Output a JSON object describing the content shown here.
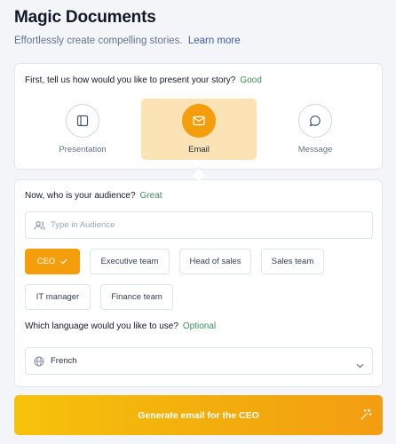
{
  "header": {
    "title": "Magic Documents",
    "subtitle": "Effortlessly create compelling stories.",
    "learn_more": "Learn more"
  },
  "present": {
    "question": "First, tell us how would you like to present your story?",
    "hint": "Good",
    "options": [
      {
        "label": "Presentation",
        "icon": "presentation-icon",
        "selected": false
      },
      {
        "label": "Email",
        "icon": "mail-icon",
        "selected": true
      },
      {
        "label": "Message",
        "icon": "chat-bubble-icon",
        "selected": false
      }
    ]
  },
  "audience": {
    "question": "Now, who is your audience?",
    "hint": "Great",
    "placeholder": "Type in Audience",
    "chips": [
      {
        "label": "CEO",
        "selected": true
      },
      {
        "label": "Executive team",
        "selected": false
      },
      {
        "label": "Head of sales",
        "selected": false
      },
      {
        "label": "Sales team",
        "selected": false
      },
      {
        "label": "IT manager",
        "selected": false
      },
      {
        "label": "Finance team",
        "selected": false
      }
    ]
  },
  "language": {
    "question": "Which language would you like to use?",
    "hint": "Optional",
    "value": "French",
    "icon": "globe-icon"
  },
  "generate": {
    "label": "Generate email for the CEO",
    "icon": "magic-wand-icon"
  },
  "colors": {
    "accent": "#f59e0b",
    "selected_bg": "#fbe3b6",
    "hint_green": "#3f8f5a",
    "link_blue": "#3b5ba8"
  }
}
